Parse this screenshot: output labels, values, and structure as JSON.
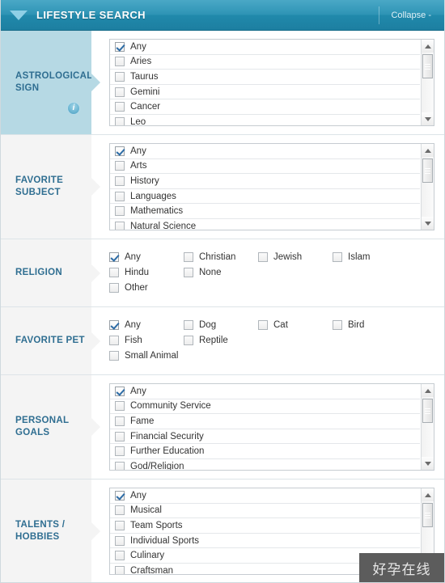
{
  "header": {
    "title": "LIFESTYLE SEARCH",
    "collapse_label": "Collapse -",
    "caret_icon": "chevron-down-icon",
    "bg_color": "#2089ab",
    "text_color": "#ffffff"
  },
  "colors": {
    "accent_panel": "#b6d9e4",
    "panel": "#f4f4f4",
    "label_text": "#2f6e91",
    "check_mark": "#2d6ca6"
  },
  "sections": [
    {
      "label": "ASTROLOGICAL\nSIGN",
      "name": "astrological-sign",
      "accent": true,
      "info_icon": "info-icon",
      "type": "scroll-list",
      "options": [
        {
          "label": "Any",
          "checked": true
        },
        {
          "label": "Aries",
          "checked": false
        },
        {
          "label": "Taurus",
          "checked": false
        },
        {
          "label": "Gemini",
          "checked": false
        },
        {
          "label": "Cancer",
          "checked": false
        },
        {
          "label": "Leo",
          "checked": false
        }
      ]
    },
    {
      "label": "FAVORITE\nSUBJECT",
      "name": "favorite-subject",
      "accent": false,
      "info_icon": null,
      "type": "scroll-list",
      "options": [
        {
          "label": "Any",
          "checked": true
        },
        {
          "label": "Arts",
          "checked": false
        },
        {
          "label": "History",
          "checked": false
        },
        {
          "label": "Languages",
          "checked": false
        },
        {
          "label": "Mathematics",
          "checked": false
        },
        {
          "label": "Natural Science",
          "checked": false
        }
      ]
    },
    {
      "label": "RELIGION",
      "name": "religion",
      "accent": false,
      "info_icon": null,
      "type": "grid",
      "options": [
        {
          "label": "Any",
          "checked": true
        },
        {
          "label": "Christian",
          "checked": false
        },
        {
          "label": "Jewish",
          "checked": false
        },
        {
          "label": "Islam",
          "checked": false
        },
        {
          "label": "Hindu",
          "checked": false
        },
        {
          "label": "None",
          "checked": false
        },
        {
          "label": "Other",
          "checked": false
        }
      ]
    },
    {
      "label": "FAVORITE PET",
      "name": "favorite-pet",
      "accent": false,
      "info_icon": null,
      "type": "grid",
      "options": [
        {
          "label": "Any",
          "checked": true
        },
        {
          "label": "Dog",
          "checked": false
        },
        {
          "label": "Cat",
          "checked": false
        },
        {
          "label": "Bird",
          "checked": false
        },
        {
          "label": "Fish",
          "checked": false
        },
        {
          "label": "Reptile",
          "checked": false
        },
        {
          "label": "Small Animal",
          "checked": false
        }
      ]
    },
    {
      "label": "PERSONAL\nGOALS",
      "name": "personal-goals",
      "accent": false,
      "info_icon": null,
      "type": "scroll-list",
      "options": [
        {
          "label": "Any",
          "checked": true
        },
        {
          "label": "Community Service",
          "checked": false
        },
        {
          "label": "Fame",
          "checked": false
        },
        {
          "label": "Financial Security",
          "checked": false
        },
        {
          "label": "Further Education",
          "checked": false
        },
        {
          "label": "God/Religion",
          "checked": false
        }
      ]
    },
    {
      "label": "TALENTS /\nHOBBIES",
      "name": "talents-hobbies",
      "accent": false,
      "info_icon": null,
      "type": "scroll-list",
      "options": [
        {
          "label": "Any",
          "checked": true
        },
        {
          "label": "Musical",
          "checked": false
        },
        {
          "label": "Team Sports",
          "checked": false
        },
        {
          "label": "Individual Sports",
          "checked": false
        },
        {
          "label": "Culinary",
          "checked": false
        },
        {
          "label": "Craftsman",
          "checked": false
        }
      ]
    }
  ],
  "watermark": {
    "text": "好孕在线"
  }
}
